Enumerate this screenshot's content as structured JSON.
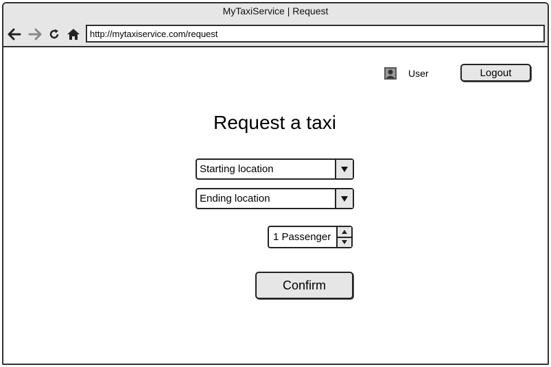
{
  "window": {
    "title": "MyTaxiService | Request"
  },
  "browser": {
    "url": "http://mytaxiservice.com/request",
    "icons": [
      "back-arrow-icon",
      "forward-arrow-icon",
      "reload-icon",
      "home-icon"
    ]
  },
  "header": {
    "user_label": "User",
    "logout_label": "Logout"
  },
  "main": {
    "heading": "Request a taxi",
    "start_select": "Starting location",
    "end_select": "Ending location",
    "passengers": "1 Passenger",
    "confirm_label": "Confirm"
  },
  "colors": {
    "chrome": "#e6e6e6",
    "border": "#2f2f2f",
    "button": "#e6e6e6"
  }
}
